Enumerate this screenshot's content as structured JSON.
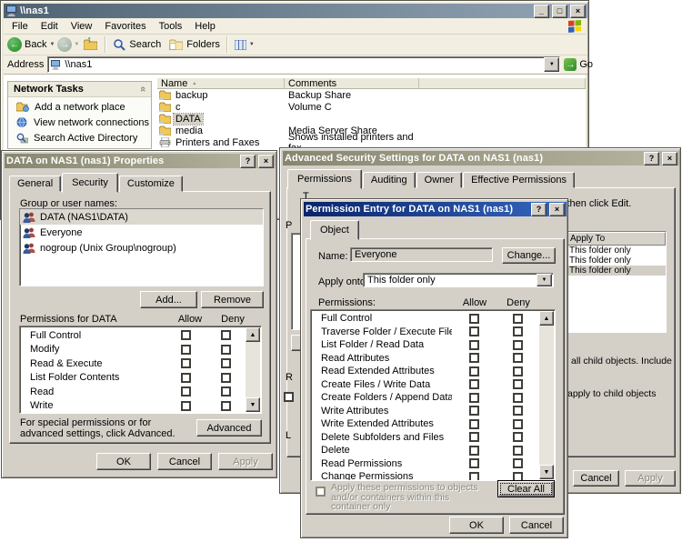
{
  "icons": {
    "minimize": "_",
    "maximize": "□",
    "close": "×",
    "help": "?",
    "dropdown": "▼",
    "up_arrow": "▲",
    "down_arrow": "▼",
    "sort_asc": "▲",
    "chevron_collapse": "«",
    "back_arrow": "←",
    "forward_arrow": "→",
    "up_nav": "↑",
    "go_arrow": "→"
  },
  "colors": {
    "titlebar_active": "#0a246a",
    "titlebar_inactive": "#87866f",
    "explorer_titlebar": "#4f6374",
    "window_face": "#d4d0c8",
    "selection_highlight": "#d5d1c6"
  },
  "explorer": {
    "title": "\\\\nas1",
    "menu": [
      "File",
      "Edit",
      "View",
      "Favorites",
      "Tools",
      "Help"
    ],
    "toolbar": {
      "back": "Back",
      "search": "Search",
      "folders": "Folders"
    },
    "address": {
      "label": "Address",
      "value": "\\\\nas1",
      "go": "Go"
    },
    "tasks": {
      "header": "Network Tasks",
      "items": [
        "Add a network place",
        "View network connections",
        "Search Active Directory"
      ]
    },
    "columns": [
      "Name",
      "Comments"
    ],
    "files": [
      {
        "name": "backup",
        "comment": "Backup Share"
      },
      {
        "name": "c",
        "comment": "Volume C"
      },
      {
        "name": "DATA",
        "comment": ""
      },
      {
        "name": "media",
        "comment": "Media Server Share"
      },
      {
        "name": "Printers and Faxes",
        "comment": "Shows installed printers and fax ..."
      }
    ]
  },
  "properties": {
    "title": "DATA on NAS1 (nas1) Properties",
    "tabs": [
      "General",
      "Security",
      "Customize"
    ],
    "group_label": "Group or user names:",
    "groups": [
      "DATA (NAS1\\DATA)",
      "Everyone",
      "nogroup (Unix Group\\nogroup)"
    ],
    "add_button": "Add...",
    "remove_button": "Remove",
    "permissions_label": "Permissions for DATA",
    "allow_header": "Allow",
    "deny_header": "Deny",
    "permissions": [
      "Full Control",
      "Modify",
      "Read & Execute",
      "List Folder Contents",
      "Read",
      "Write"
    ],
    "advanced_note": "For special permissions or for advanced settings, click Advanced.",
    "advanced_button": "Advanced",
    "ok_button": "OK",
    "cancel_button": "Cancel",
    "apply_button": "Apply"
  },
  "advanced": {
    "title": "Advanced Security Settings for DATA on NAS1 (nas1)",
    "tabs": [
      "Permissions",
      "Auditing",
      "Owner",
      "Effective Permissions"
    ],
    "instruction_fragment_left": "T",
    "instruction_fragment_right": "and then click Edit.",
    "entries_label_fragment": "P",
    "replace_fragment_letter": "R",
    "learn_fragment_letter": "L",
    "apply_to_header": "Apply To",
    "apply_to_rows": [
      "This folder only",
      "This folder only",
      "This folder only"
    ],
    "inherit_text_fragment": "all child objects. Include",
    "replace_text_fragment": "apply to child objects",
    "cancel_button": "Cancel",
    "apply_button": "Apply"
  },
  "permission_entry": {
    "title": "Permission Entry for DATA on NAS1 (nas1)",
    "tab": "Object",
    "name_label": "Name:",
    "name_value": "Everyone",
    "change_button": "Change...",
    "apply_onto_label": "Apply onto:",
    "apply_onto_value": "This folder only",
    "permissions_label": "Permissions:",
    "allow_header": "Allow",
    "deny_header": "Deny",
    "permissions": [
      "Full Control",
      "Traverse Folder / Execute File",
      "List Folder / Read Data",
      "Read Attributes",
      "Read Extended Attributes",
      "Create Files / Write Data",
      "Create Folders / Append Data",
      "Write Attributes",
      "Write Extended Attributes",
      "Delete Subfolders and Files",
      "Delete",
      "Read Permissions",
      "Change Permissions"
    ],
    "apply_checkbox_label": "Apply these permissions to objects and/or containers within this container only",
    "clear_all_button": "Clear All",
    "ok_button": "OK",
    "cancel_button": "Cancel"
  }
}
